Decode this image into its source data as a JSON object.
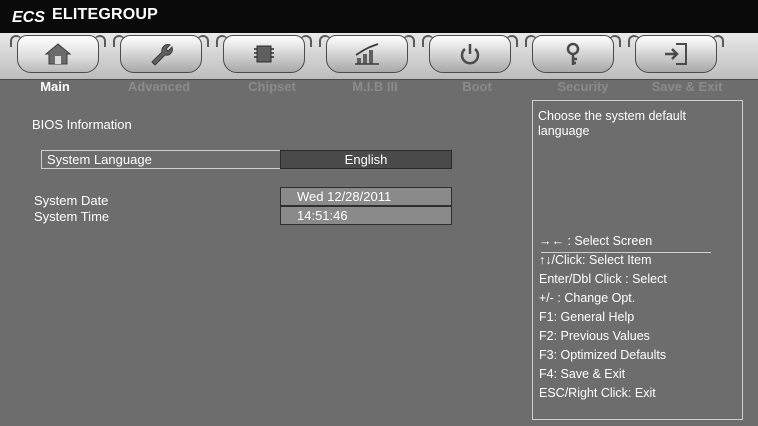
{
  "brand": {
    "name": "ELITEGROUP",
    "logo": "ECS"
  },
  "tabs": [
    {
      "label": "Main",
      "icon": "home-icon",
      "active": true
    },
    {
      "label": "Advanced",
      "icon": "wrench-icon",
      "active": false
    },
    {
      "label": "Chipset",
      "icon": "chip-icon",
      "active": false
    },
    {
      "label": "M.I.B III",
      "icon": "bar-chart-icon",
      "active": false
    },
    {
      "label": "Boot",
      "icon": "power-icon",
      "active": false
    },
    {
      "label": "Security",
      "icon": "key-icon",
      "active": false
    },
    {
      "label": "Save & Exit",
      "icon": "exit-icon",
      "active": false
    }
  ],
  "main": {
    "section_title": "BIOS Information",
    "language": {
      "label": "System Language",
      "value": "English"
    },
    "date": {
      "label": "System Date",
      "value": "Wed 12/28/2011"
    },
    "time": {
      "label": "System Time",
      "value": "14:51:46"
    }
  },
  "help": {
    "description": "Choose the system default language",
    "keys": [
      "→←  : Select Screen",
      "↑↓/Click: Select Item",
      "Enter/Dbl Click : Select",
      "+/- : Change Opt.",
      "F1: General Help",
      "F2: Previous Values",
      "F3: Optimized Defaults",
      "F4: Save & Exit",
      "ESC/Right Click: Exit"
    ]
  },
  "colors": {
    "background": "#6d6d6d",
    "titlebar": "#0a0a0a",
    "active_tab_label": "#ffffff",
    "inactive_tab_label": "#8b8b8b",
    "select_bg": "#4a4a4a"
  }
}
